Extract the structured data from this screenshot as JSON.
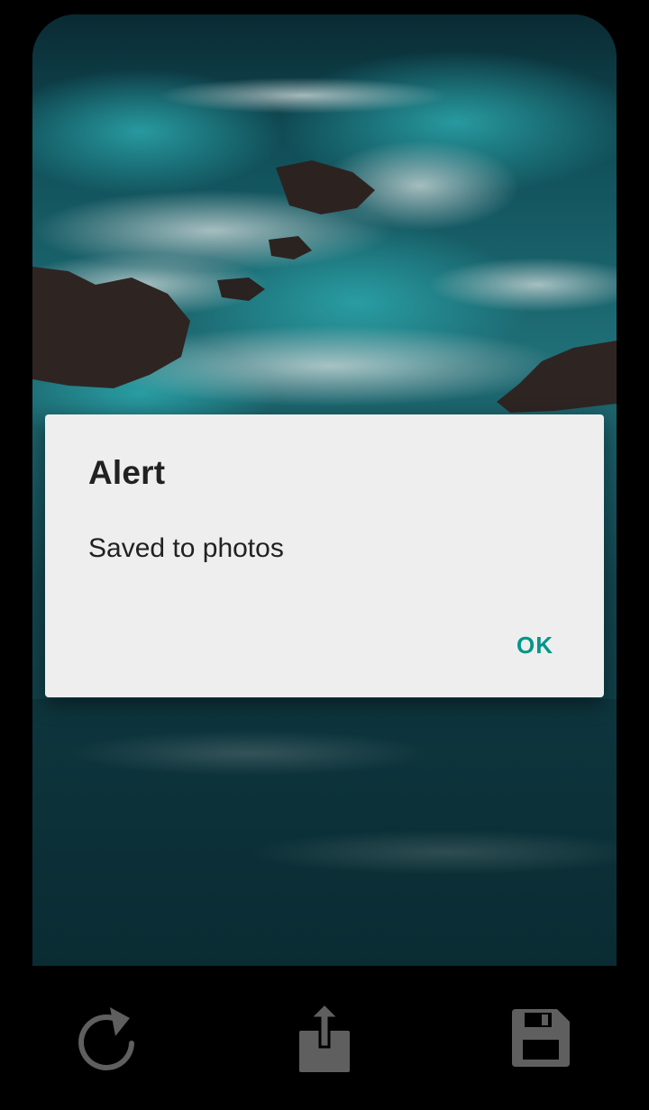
{
  "dialog": {
    "title": "Alert",
    "message": "Saved to photos",
    "ok_label": "OK"
  },
  "toolbar": {
    "buttons": [
      {
        "name": "refresh",
        "icon": "refresh-icon"
      },
      {
        "name": "share",
        "icon": "share-icon"
      },
      {
        "name": "save",
        "icon": "save-icon"
      }
    ]
  },
  "colors": {
    "accent": "#009688",
    "dialog_background": "#eeeeee",
    "icon_color": "#5f5f5f",
    "background": "#000000"
  }
}
